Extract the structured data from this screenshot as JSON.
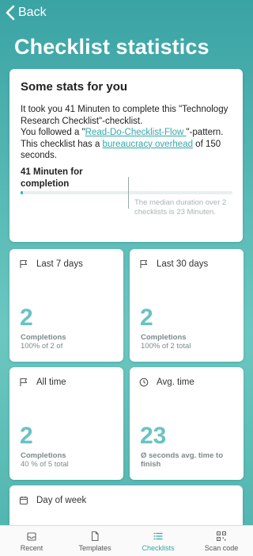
{
  "nav": {
    "back_label": "Back"
  },
  "page": {
    "title": "Checklist statistics"
  },
  "summary": {
    "heading": "Some stats for you",
    "line1": "It took you 41 Minuten to complete this \"Technology Research Checklist\"-checklist.",
    "line2_pre": "You followed a \"",
    "line2_link": "Read-Do-Checklist-Flow ",
    "line2_post": "\"-pattern.",
    "line3_pre": "This checklist has a ",
    "line3_link": "bureaucracy overhead",
    "line3_post": " of 150 seconds.",
    "duration_label": "41 Minuten for completion",
    "duration_fraction": 0.01,
    "median_note": "The median duration over 2 checklists is 23 Minuten."
  },
  "tiles": [
    {
      "title": "Last 7 days",
      "value": "2",
      "label_bold": "Completions",
      "label_rest": "100% of 2 of",
      "icon": "flag-icon"
    },
    {
      "title": "Last 30 days",
      "value": "2",
      "label_bold": "Completions",
      "label_rest": "100% of 2 total",
      "icon": "flag-icon"
    },
    {
      "title": "All time",
      "value": "2",
      "label_bold": "Completions",
      "label_rest": "40 % of 5 total",
      "icon": "flag-icon"
    },
    {
      "title": "Avg. time",
      "value": "23",
      "label_bold": "Ø seconds avg. time to finish",
      "label_rest": "",
      "icon": "clock-icon"
    }
  ],
  "day_of_week": {
    "title": "Day of week",
    "icon": "calendar-icon"
  },
  "tabbar": {
    "items": [
      {
        "label": "Recent",
        "icon": "inbox-icon",
        "active": false
      },
      {
        "label": "Templates",
        "icon": "document-icon",
        "active": false
      },
      {
        "label": "Checklists",
        "icon": "list-icon",
        "active": true
      },
      {
        "label": "Scan code",
        "icon": "qr-code-icon",
        "active": false
      }
    ]
  },
  "colors": {
    "accent": "#36a7a8",
    "number": "#6ac2c4",
    "background": "#58b9b5"
  }
}
